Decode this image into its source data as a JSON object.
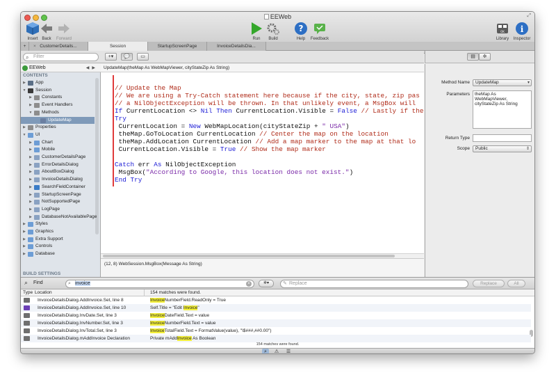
{
  "window": {
    "title": "EEWeb"
  },
  "toolbar": {
    "insert": "Insert",
    "back": "Back",
    "forward": "Forward",
    "run": "Run",
    "build": "Build",
    "help": "Help",
    "feedback": "Feedback",
    "library": "Library",
    "inspector": "Inspector"
  },
  "tabs": [
    {
      "label": "CustomerDetails..."
    },
    {
      "label": "Session"
    },
    {
      "label": "StartupScreenPage"
    },
    {
      "label": "InvoiceDetailsDia..."
    }
  ],
  "navigator": {
    "filter_placeholder": "Filter",
    "project": "EEWeb",
    "contents_header": "CONTENTS",
    "build_settings_header": "BUILD SETTINGS",
    "items": [
      {
        "label": "App",
        "icon": "app-icon",
        "level": 0,
        "open": false
      },
      {
        "label": "Session",
        "icon": "session-icon",
        "level": 0,
        "open": true
      },
      {
        "label": "Constants",
        "icon": "constants-icon",
        "level": 1,
        "open": false
      },
      {
        "label": "Event Handlers",
        "icon": "event-handlers-icon",
        "level": 1,
        "open": false
      },
      {
        "label": "Methods",
        "icon": "methods-icon",
        "level": 1,
        "open": true
      },
      {
        "label": "UpdateMap",
        "icon": "method-icon",
        "level": 2,
        "selected": true
      },
      {
        "label": "Properties",
        "icon": "properties-icon",
        "level": 0,
        "open": false
      },
      {
        "label": "UI",
        "icon": "folder-icon",
        "level": 0,
        "open": true
      },
      {
        "label": "Chart",
        "icon": "folder-icon",
        "level": 1,
        "open": false
      },
      {
        "label": "Mobile",
        "icon": "folder-icon",
        "level": 1,
        "open": false
      },
      {
        "label": "CustomerDetailsPage",
        "icon": "page-icon",
        "level": 1,
        "open": false
      },
      {
        "label": "ErrorDetailsDialog",
        "icon": "dialog-icon",
        "level": 1,
        "open": false
      },
      {
        "label": "AboutBoxDialog",
        "icon": "dialog-icon",
        "level": 1,
        "open": false
      },
      {
        "label": "InvoiceDetailsDialog",
        "icon": "dialog-icon",
        "level": 1,
        "open": false
      },
      {
        "label": "SearchFieldContainer",
        "icon": "container-icon",
        "level": 1,
        "open": false
      },
      {
        "label": "StartupScreenPage",
        "icon": "page-icon",
        "level": 1,
        "open": false
      },
      {
        "label": "NotSupportedPage",
        "icon": "page-icon",
        "level": 1,
        "open": false
      },
      {
        "label": "LogPage",
        "icon": "page-icon",
        "level": 1,
        "open": false
      },
      {
        "label": "DatabaseNotAvailablePage",
        "icon": "page-icon",
        "level": 1,
        "open": false
      },
      {
        "label": "Styles",
        "icon": "folder-icon",
        "level": 0,
        "open": false
      },
      {
        "label": "Graphics",
        "icon": "folder-icon",
        "level": 0,
        "open": false
      },
      {
        "label": "Extra Support",
        "icon": "folder-icon",
        "level": 0,
        "open": false
      },
      {
        "label": "Controls",
        "icon": "folder-icon",
        "level": 0,
        "open": false
      },
      {
        "label": "Database",
        "icon": "folder-icon",
        "level": 0,
        "open": false
      }
    ]
  },
  "editor": {
    "signature": "UpdateMap(theMap As WebMapViewer, cityStateZip As String)",
    "status": "(12, 8) WebSession.MsgBox(Message As String)",
    "lines": [
      [
        {
          "t": "// Update the Map",
          "c": "cm"
        }
      ],
      [
        {
          "t": "// We are using a Try-Catch statement here because if the city, state, zip pas",
          "c": "cm"
        }
      ],
      [
        {
          "t": "// a NilObjectException will be thrown. In that unlikely event, a MsgBox will",
          "c": "cm"
        }
      ],
      [
        {
          "t": "If ",
          "c": "kw"
        },
        {
          "t": "CurrentLocation <> ",
          "c": "tx"
        },
        {
          "t": "Nil Then ",
          "c": "kw"
        },
        {
          "t": "CurrentLocation.Visible = ",
          "c": "tx"
        },
        {
          "t": "False ",
          "c": "kw"
        },
        {
          "t": "// Lastly if there's a",
          "c": "cm"
        }
      ],
      [
        {
          "t": "Try",
          "c": "kw"
        }
      ],
      [
        {
          "t": " CurrentLocation = ",
          "c": "tx"
        },
        {
          "t": "New ",
          "c": "kw"
        },
        {
          "t": "WebMapLocation(cityStateZip + ",
          "c": "tx"
        },
        {
          "t": "\" USA\"",
          "c": "st"
        },
        {
          "t": ")",
          "c": "tx"
        }
      ],
      [
        {
          "t": " theMap.GoToLocation CurrentLocation ",
          "c": "tx"
        },
        {
          "t": "// Center the map on the location",
          "c": "cm"
        }
      ],
      [
        {
          "t": " theMap.AddLocation CurrentLocation ",
          "c": "tx"
        },
        {
          "t": "// Add a map marker to the map at that lo",
          "c": "cm"
        }
      ],
      [
        {
          "t": " CurrentLocation.Visible = ",
          "c": "tx"
        },
        {
          "t": "True ",
          "c": "kw"
        },
        {
          "t": "// Show the map marker",
          "c": "cm"
        }
      ],
      [
        {
          "t": "",
          "c": "tx"
        }
      ],
      [
        {
          "t": "Catch ",
          "c": "kw"
        },
        {
          "t": "err ",
          "c": "tx"
        },
        {
          "t": "As ",
          "c": "kw"
        },
        {
          "t": "NilObjectException",
          "c": "tx"
        }
      ],
      [
        {
          "t": " MsgBox(",
          "c": "tx"
        },
        {
          "t": "\"According to Google, this location does not exist.\"",
          "c": "st"
        },
        {
          "t": ")",
          "c": "tx"
        }
      ],
      [
        {
          "t": "End Try",
          "c": "kw"
        }
      ]
    ]
  },
  "inspector": {
    "method_name_label": "Method Name",
    "method_name": "UpdateMap",
    "parameters_label": "Parameters",
    "parameters": "theMap As WebMapViewer, cityStateZip As String",
    "return_type_label": "Return Type",
    "return_type": "",
    "scope_label": "Scope",
    "scope": "Public"
  },
  "find": {
    "label": "Find",
    "query": "invoice",
    "replace_placeholder": "Replace",
    "replace_button": "Replace",
    "all_button": "All",
    "col_type": "Type",
    "col_location": "Location",
    "summary": "154 matches were found.",
    "footer": "154 matches were found.",
    "results": [
      {
        "location": "InvoiceDetailsDialog.AddInvoice.Set, line 8",
        "pre": "",
        "match": "Invoice",
        "post": "NumberField.ReadOnly = True",
        "icon": "code-icon"
      },
      {
        "location": "InvoiceDetailsDialog.AddInvoice.Set, line 10",
        "pre": "Self.Title = \"Edit ",
        "match": "Invoice",
        "post": "\"",
        "icon": "method-purple-icon"
      },
      {
        "location": "InvoiceDetailsDialog.InvDate.Set, line 3",
        "pre": "",
        "match": "Invoice",
        "post": "DateField.Text = value",
        "icon": "code-icon"
      },
      {
        "location": "InvoiceDetailsDialog.InvNumber.Set, line 3",
        "pre": "",
        "match": "Invoice",
        "post": "NumberField.Text = value",
        "icon": "code-icon"
      },
      {
        "location": "InvoiceDetailsDialog.InvTotal.Set, line 3",
        "pre": "",
        "match": "Invoice",
        "post": "TotalField.Text = FormatValue(value), \"\\$###,##0.00\")",
        "icon": "code-icon"
      },
      {
        "location": "InvoiceDetailsDialog.mAddInvoice Declaration",
        "pre": "Private mAdd",
        "match": "Invoice",
        "post": " As Boolean",
        "icon": "code-icon"
      }
    ]
  },
  "colors": {
    "comment": "#b02c1a",
    "keyword": "#1d1dd6",
    "string": "#7a2aa8",
    "highlight": "#f5f13a",
    "selection": "#7f9ab9"
  }
}
